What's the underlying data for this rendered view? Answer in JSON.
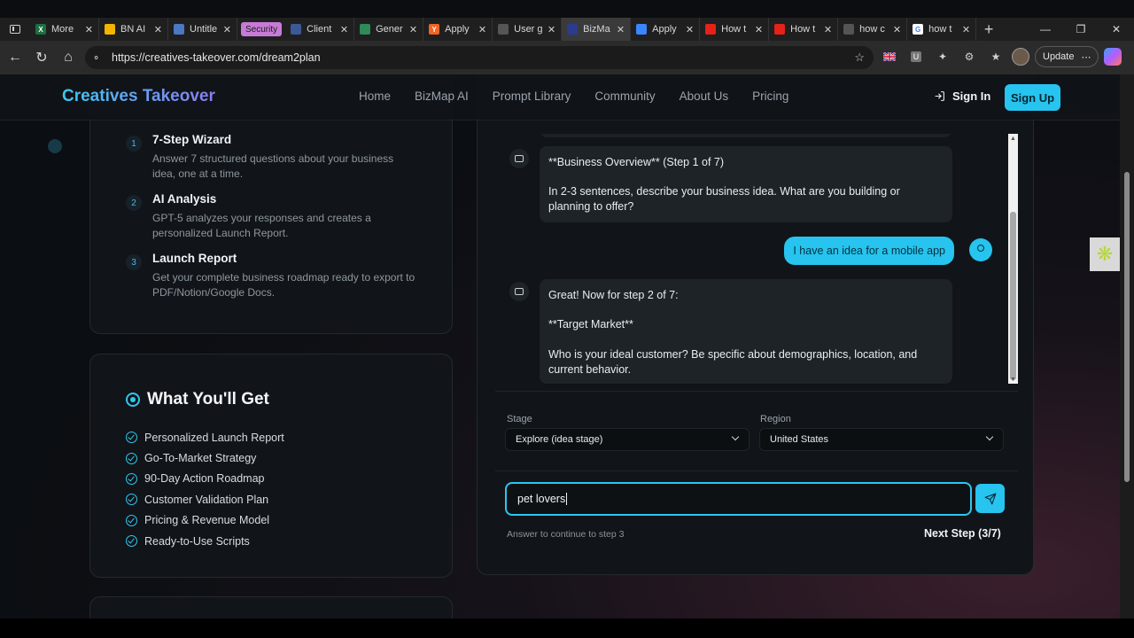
{
  "browser": {
    "tabs": [
      {
        "label": "More",
        "icon": "excel-icon",
        "color": "#1d6f42",
        "glyph": "X"
      },
      {
        "label": "BN AI",
        "icon": "drive-icon",
        "color": "#f4b400",
        "glyph": ""
      },
      {
        "label": "Untitle",
        "icon": "docs-icon",
        "color": "#4a78c2",
        "glyph": ""
      },
      {
        "label": "Client",
        "icon": "shield-icon",
        "color": "#3b5998",
        "glyph": ""
      },
      {
        "label": "Gener",
        "icon": "spark-icon",
        "color": "#2e8b57",
        "glyph": ""
      },
      {
        "label": "Apply",
        "icon": "ycombinator-icon",
        "color": "#f26522",
        "glyph": "Y"
      },
      {
        "label": "User g",
        "icon": "openai-icon",
        "color": "#555555",
        "glyph": ""
      },
      {
        "label": "BizMa",
        "icon": "bizmap-icon",
        "color": "#2b3b8f",
        "glyph": ""
      },
      {
        "label": "Apply",
        "icon": "chart-icon",
        "color": "#3a86ff",
        "glyph": ""
      },
      {
        "label": "How t",
        "icon": "youtube-icon",
        "color": "#e62117",
        "glyph": ""
      },
      {
        "label": "How t",
        "icon": "youtube-icon",
        "color": "#e62117",
        "glyph": ""
      },
      {
        "label": "how c",
        "icon": "openai-icon",
        "color": "#555555",
        "glyph": ""
      },
      {
        "label": "how t",
        "icon": "google-icon",
        "color": "#ffffff",
        "glyph": "G"
      }
    ],
    "tab_group_label": "Security",
    "url": "https://creatives-takeover.com/dream2plan",
    "update_label": "Update"
  },
  "site": {
    "brand": "Creatives Takeover",
    "nav": [
      "Home",
      "BizMap AI",
      "Prompt Library",
      "Community",
      "About Us",
      "Pricing"
    ],
    "sign_in": "Sign In",
    "sign_up": "Sign Up"
  },
  "steps": [
    {
      "num": "1",
      "title": "7-Step Wizard",
      "desc": "Answer 7 structured questions about your business idea, one at a time."
    },
    {
      "num": "2",
      "title": "AI Analysis",
      "desc": "GPT-5 analyzes your responses and creates a personalized Launch Report."
    },
    {
      "num": "3",
      "title": "Launch Report",
      "desc": "Get your complete business roadmap ready to export to PDF/Notion/Google Docs."
    }
  ],
  "what_youll_get": {
    "title": "What You'll Get",
    "items": [
      "Personalized Launch Report",
      "Go-To-Market Strategy",
      "90-Day Action Roadmap",
      "Customer Validation Plan",
      "Pricing & Revenue Model",
      "Ready-to-Use Scripts"
    ]
  },
  "chat": {
    "messages": [
      {
        "role": "bot",
        "text": "**Business Overview** (Step 1 of 7)\n\nIn 2-3 sentences, describe your business idea. What are you building or planning to offer?"
      },
      {
        "role": "user",
        "text": "I have an idea for a mobile app"
      },
      {
        "role": "bot",
        "text": "Great! Now for step 2 of 7:\n\n**Target Market**\n\nWho is your ideal customer? Be specific about demographics, location, and current behavior."
      }
    ],
    "stage_label": "Stage",
    "stage_value": "Explore (idea stage)",
    "region_label": "Region",
    "region_value": "United States",
    "input_value": "pet lovers",
    "hint": "Answer to continue to step 3",
    "next_step": "Next Step (3/7)"
  },
  "colors": {
    "accent": "#26c4ef",
    "panel": "#111519",
    "bubble": "#1e2328"
  }
}
